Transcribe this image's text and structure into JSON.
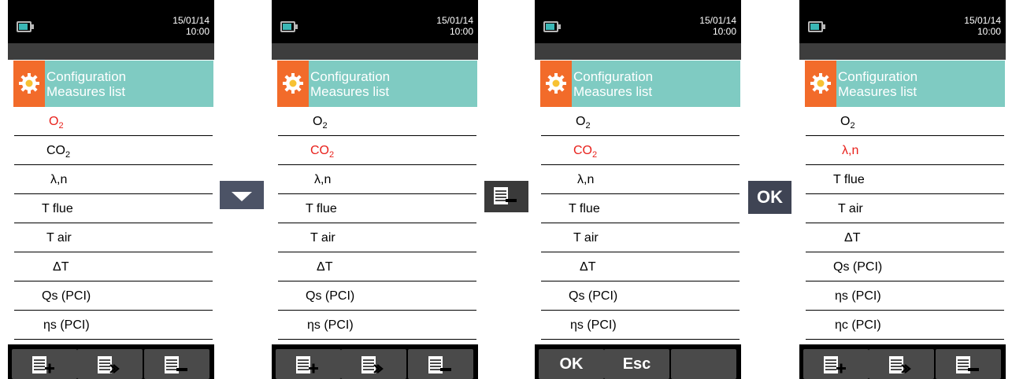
{
  "screens": [
    {
      "date": "15/01/14",
      "time": "10:00",
      "title_line1": "Configuration",
      "title_line2": "Measures list",
      "items": [
        {
          "base": "O",
          "sub": "2",
          "selected": true
        },
        {
          "base": "CO",
          "sub": "2",
          "selected": false
        },
        {
          "base": "λ,n",
          "sub": "",
          "selected": false
        },
        {
          "base": "T flue",
          "sub": "",
          "selected": false
        },
        {
          "base": "T air",
          "sub": "",
          "selected": false
        },
        {
          "base": "ΔT",
          "sub": "",
          "selected": false
        },
        {
          "base": "Qs (PCI)",
          "sub": "",
          "selected": false
        },
        {
          "base": "ηs (PCI)",
          "sub": "",
          "selected": false
        }
      ],
      "softkeys": [
        {
          "icon": "list-add-icon",
          "label": ""
        },
        {
          "icon": "list-insert-icon",
          "label": ""
        },
        {
          "icon": "list-remove-icon",
          "label": ""
        }
      ]
    },
    {
      "date": "15/01/14",
      "time": "10:00",
      "title_line1": "Configuration",
      "title_line2": "Measures list",
      "items": [
        {
          "base": "O",
          "sub": "2",
          "selected": false
        },
        {
          "base": "CO",
          "sub": "2",
          "selected": true
        },
        {
          "base": "λ,n",
          "sub": "",
          "selected": false
        },
        {
          "base": "T flue",
          "sub": "",
          "selected": false
        },
        {
          "base": "T air",
          "sub": "",
          "selected": false
        },
        {
          "base": "ΔT",
          "sub": "",
          "selected": false
        },
        {
          "base": "Qs (PCI)",
          "sub": "",
          "selected": false
        },
        {
          "base": "ηs (PCI)",
          "sub": "",
          "selected": false
        }
      ],
      "softkeys": [
        {
          "icon": "list-add-icon",
          "label": ""
        },
        {
          "icon": "list-insert-icon",
          "label": ""
        },
        {
          "icon": "list-remove-icon",
          "label": ""
        }
      ]
    },
    {
      "date": "15/01/14",
      "time": "10:00",
      "title_line1": "Configuration",
      "title_line2": "Measures list",
      "items": [
        {
          "base": "O",
          "sub": "2",
          "selected": false
        },
        {
          "base": "CO",
          "sub": "2",
          "selected": true
        },
        {
          "base": "λ,n",
          "sub": "",
          "selected": false
        },
        {
          "base": "T flue",
          "sub": "",
          "selected": false
        },
        {
          "base": "T air",
          "sub": "",
          "selected": false
        },
        {
          "base": "ΔT",
          "sub": "",
          "selected": false
        },
        {
          "base": "Qs (PCI)",
          "sub": "",
          "selected": false
        },
        {
          "base": "ηs (PCI)",
          "sub": "",
          "selected": false
        }
      ],
      "softkeys": [
        {
          "icon": "",
          "label": "OK"
        },
        {
          "icon": "",
          "label": "Esc"
        },
        {
          "icon": "",
          "label": ""
        }
      ]
    },
    {
      "date": "15/01/14",
      "time": "10:00",
      "title_line1": "Configuration",
      "title_line2": "Measures list",
      "items": [
        {
          "base": "O",
          "sub": "2",
          "selected": false
        },
        {
          "base": "λ,n",
          "sub": "",
          "selected": true
        },
        {
          "base": "T flue",
          "sub": "",
          "selected": false
        },
        {
          "base": "T air",
          "sub": "",
          "selected": false
        },
        {
          "base": "ΔT",
          "sub": "",
          "selected": false
        },
        {
          "base": "Qs (PCI)",
          "sub": "",
          "selected": false
        },
        {
          "base": "ηs (PCI)",
          "sub": "",
          "selected": false
        },
        {
          "base": "ηc (PCI)",
          "sub": "",
          "selected": false
        }
      ],
      "softkeys": [
        {
          "icon": "list-add-icon",
          "label": ""
        },
        {
          "icon": "list-insert-icon",
          "label": ""
        },
        {
          "icon": "list-remove-icon",
          "label": ""
        }
      ]
    }
  ],
  "step_buttons": [
    {
      "icon": "arrow-down-icon",
      "label": ""
    },
    {
      "icon": "list-remove-icon",
      "label": ""
    },
    {
      "icon": "",
      "label": "OK"
    }
  ],
  "colors": {
    "accent_orange": "#f26b2a",
    "title_teal": "#7fcbc2",
    "selected_red": "#e8201b"
  }
}
